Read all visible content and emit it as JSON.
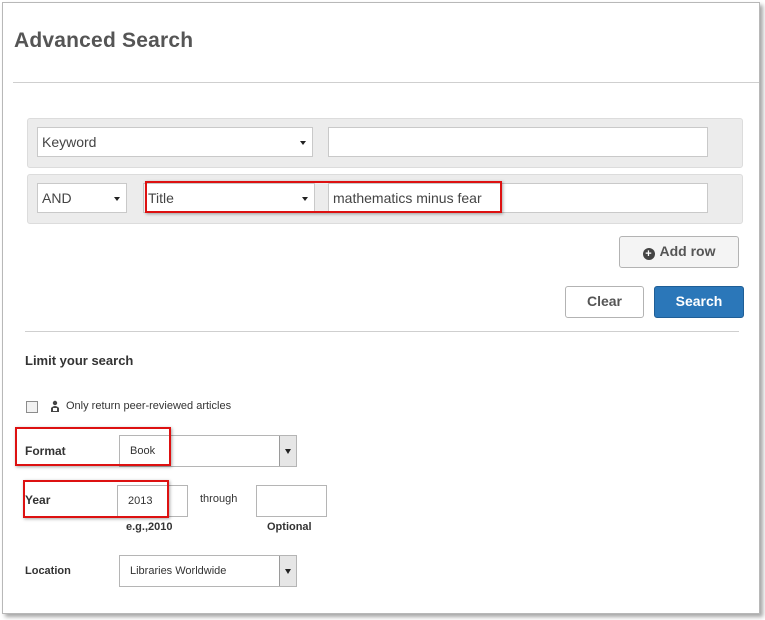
{
  "page": {
    "title": "Advanced Search"
  },
  "search_rows": [
    {
      "field": "Keyword",
      "value": ""
    },
    {
      "operator": "AND",
      "field": "Title",
      "value": "mathematics minus fear"
    }
  ],
  "buttons": {
    "add_row": "Add row",
    "clear": "Clear",
    "search": "Search"
  },
  "limits": {
    "heading": "Limit your search",
    "peer_reviewed_label": "Only return peer-reviewed articles",
    "peer_reviewed_checked": false,
    "format_label": "Format",
    "format_value": "Book",
    "year_label": "Year",
    "year_from": "2013",
    "year_from_hint": "e.g.,2010",
    "through_label": "through",
    "year_to": "",
    "year_to_hint": "Optional",
    "location_label": "Location",
    "location_value": "Libraries Worldwide"
  },
  "colors": {
    "primary_button": "#2b77b9",
    "highlight": "#dd1111"
  }
}
